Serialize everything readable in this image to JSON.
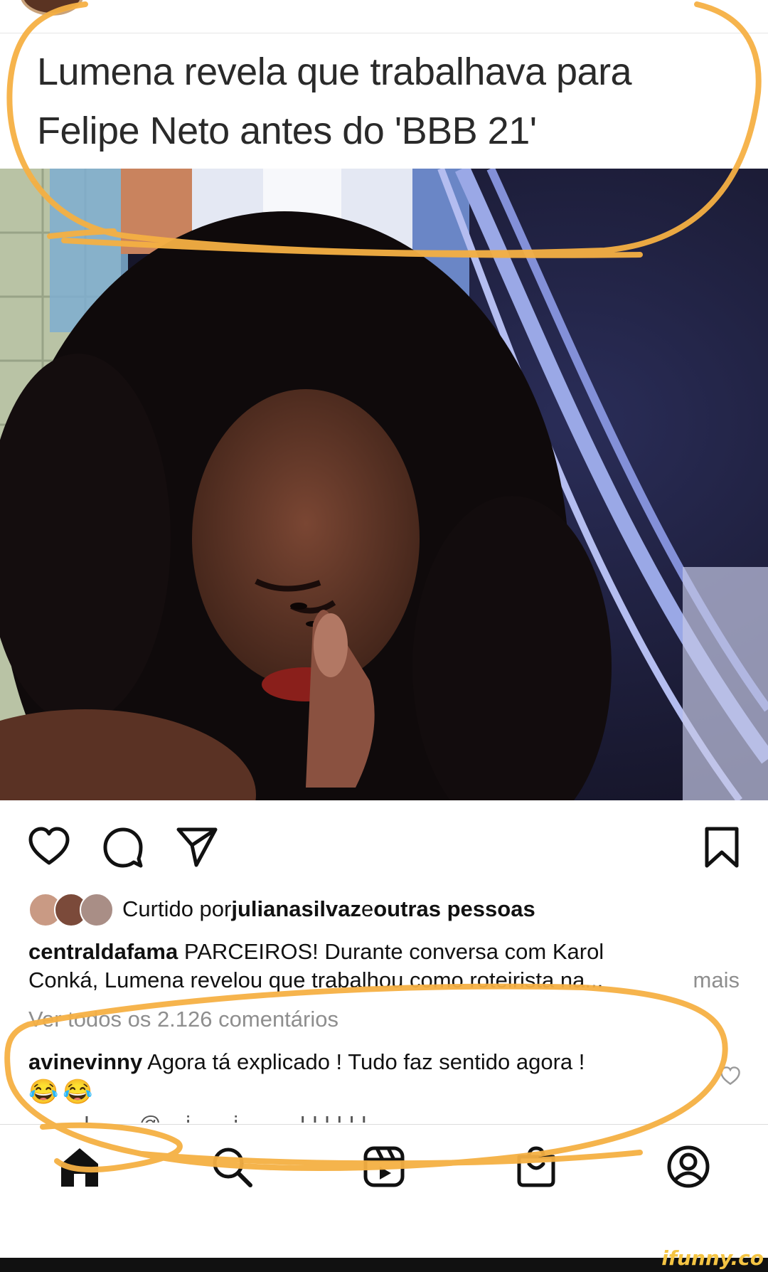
{
  "post": {
    "headline_line1": "Lumena revela que trabalhava para",
    "headline_line2": "Felipe Neto antes do 'BBB 21'"
  },
  "likes": {
    "prefix": "Curtido por ",
    "user": "julianasilvaz",
    "connector": " e ",
    "others": "outras pessoas"
  },
  "caption": {
    "user": "centraldafama",
    "line1": " PARCEIROS! Durante conversa com Karol",
    "line2": "Conká, Lumena revelou que trabalhou como roteirista na...",
    "more": "mais"
  },
  "comments": {
    "view_all": "Ver todos os 2.126 comentários",
    "first_user": "avinevinny",
    "first_text": " Agora tá explicado ! Tudo faz sentido agora !",
    "first_emoji": "😂😂",
    "next_preview": "____ I ___ @ _ i _ _ i _ _ _ I I I I I I"
  },
  "icons": {
    "like": "heart-icon",
    "comment": "comment-icon",
    "share": "send-icon",
    "save": "bookmark-icon",
    "sound": "speaker-icon",
    "nav": [
      "home-icon",
      "search-icon",
      "reels-icon",
      "shop-icon",
      "profile-icon"
    ]
  },
  "watermark": "ifunny.co",
  "colors": {
    "annotation": "#F5B043",
    "text": "#111111",
    "muted": "#8E8E8E"
  }
}
